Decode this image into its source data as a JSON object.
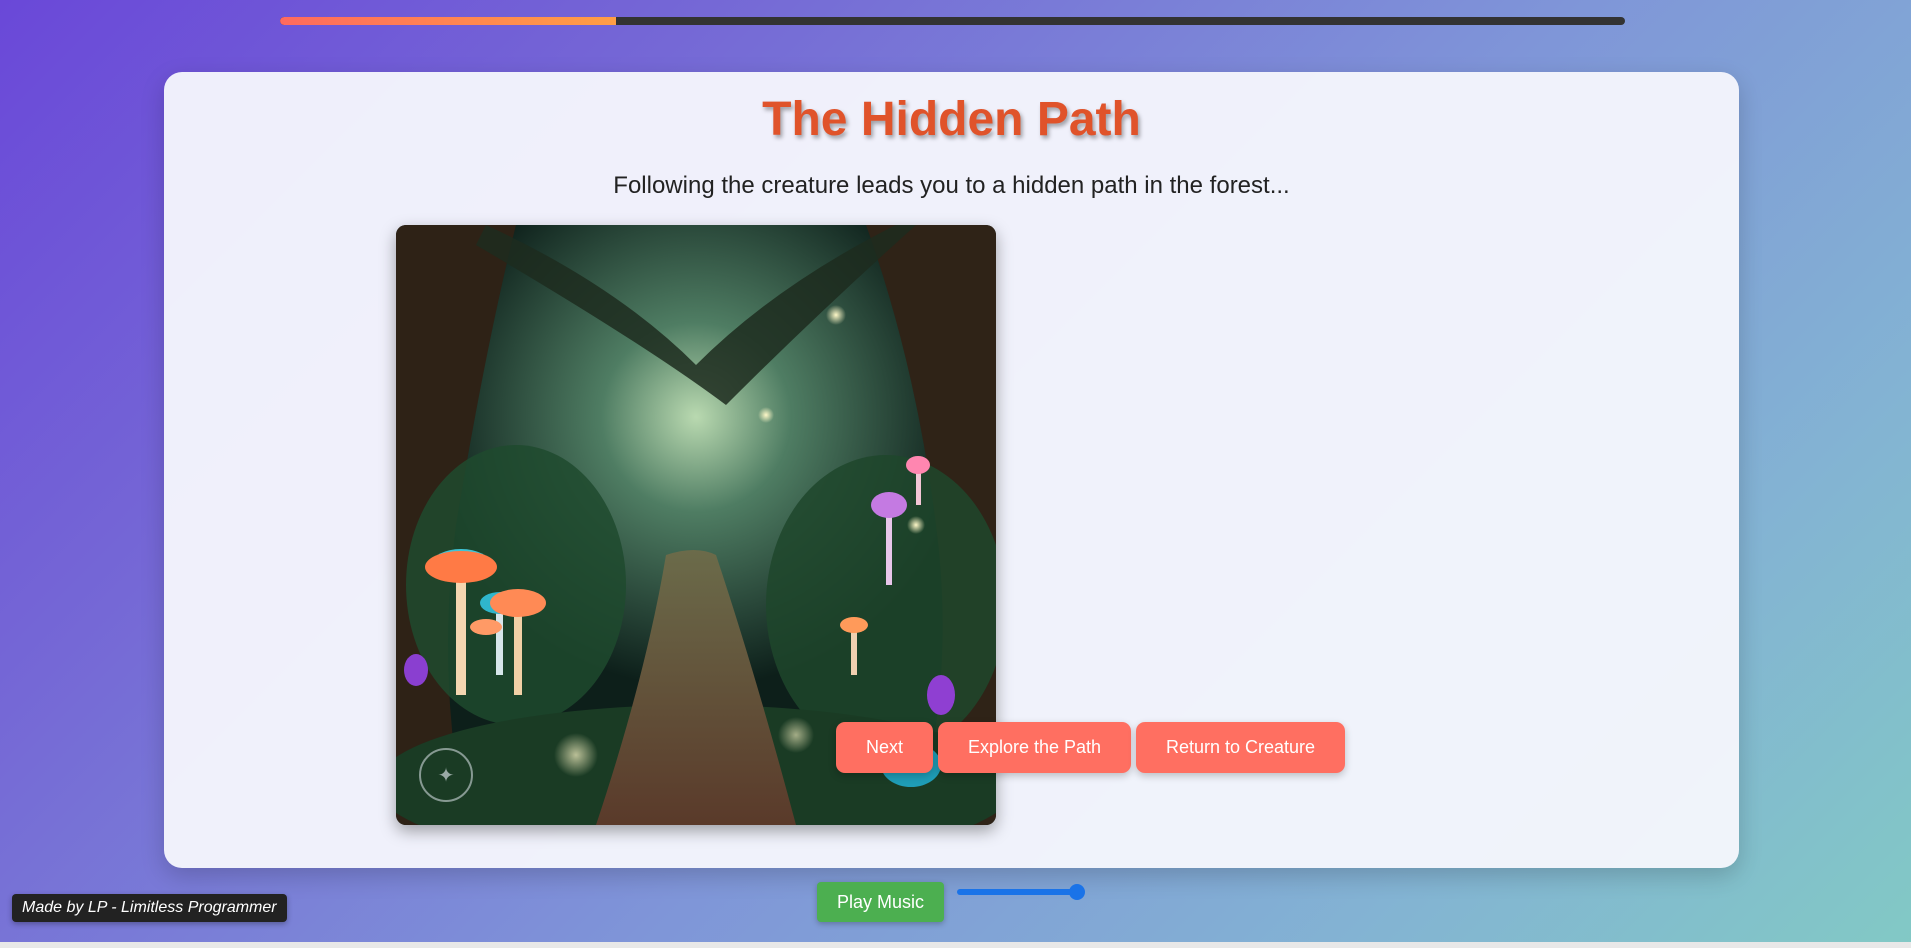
{
  "progress": {
    "value": 0.25
  },
  "story": {
    "title": "The Hidden Path",
    "description": "Following the creature leads you to a hidden path in the forest...",
    "image_subject": "enchanted forest path with glowing mushrooms"
  },
  "choices": [
    {
      "label": "Next"
    },
    {
      "label": "Explore the Path"
    },
    {
      "label": "Return to Creature"
    }
  ],
  "audio": {
    "play_label": "Play Music",
    "volume": 1.0
  },
  "credit": "Made by LP - Limitless Programmer",
  "colors": {
    "title": "#e0532a",
    "button": "#ff6f61",
    "music_button": "#4caf50",
    "slider": "#1a73e8"
  }
}
